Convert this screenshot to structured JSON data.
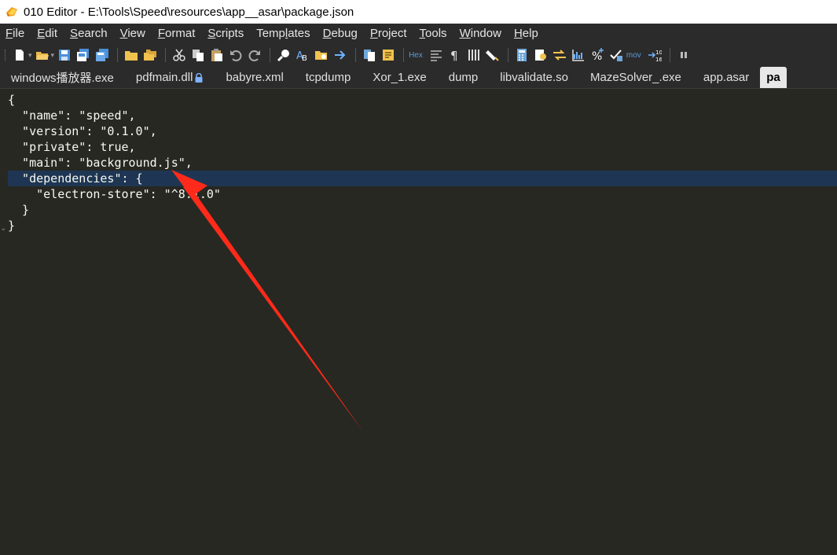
{
  "window": {
    "title": "010 Editor - E:\\Tools\\Speed\\resources\\app__asar\\package.json"
  },
  "menu": [
    {
      "u": "F",
      "rest": "ile"
    },
    {
      "u": "E",
      "rest": "dit"
    },
    {
      "u": "S",
      "rest": "earch"
    },
    {
      "u": "V",
      "rest": "iew"
    },
    {
      "u": "F",
      "rest": "ormat",
      "pre": ""
    },
    {
      "u": "S",
      "rest": "cripts"
    },
    {
      "pre": "Temp",
      "u": "l",
      "rest": "ates"
    },
    {
      "u": "D",
      "rest": "ebug"
    },
    {
      "u": "P",
      "rest": "roject"
    },
    {
      "u": "T",
      "rest": "ools"
    },
    {
      "u": "W",
      "rest": "indow"
    },
    {
      "u": "H",
      "rest": "elp"
    }
  ],
  "toolbar": {
    "hex_label": "Hex",
    "mov_label": "mov"
  },
  "tabs": [
    {
      "label": "windows播放器.exe"
    },
    {
      "label": "pdfmain.dll",
      "locked": true
    },
    {
      "label": "babyre.xml"
    },
    {
      "label": "tcpdump"
    },
    {
      "label": "Xor_1.exe"
    },
    {
      "label": "dump"
    },
    {
      "label": "libvalidate.so"
    },
    {
      "label": "MazeSolver_.exe"
    },
    {
      "label": "app.asar"
    },
    {
      "label": "pa",
      "active": true
    }
  ],
  "editor": {
    "lines": [
      "{",
      "  \"name\": \"speed\",",
      "  \"version\": \"0.1.0\",",
      "  \"private\": true,",
      "  \"main\": \"background.js\",",
      "  \"dependencies\": {",
      "    \"electron-store\": \"^8.1.0\"",
      "  }",
      "}"
    ],
    "highlight_line": 5,
    "colors": {
      "background": "#272822",
      "text": "#f8f8f2",
      "highlight": "#1e3653"
    }
  },
  "annotation": {
    "arrow_color": "#ff2a1a"
  }
}
